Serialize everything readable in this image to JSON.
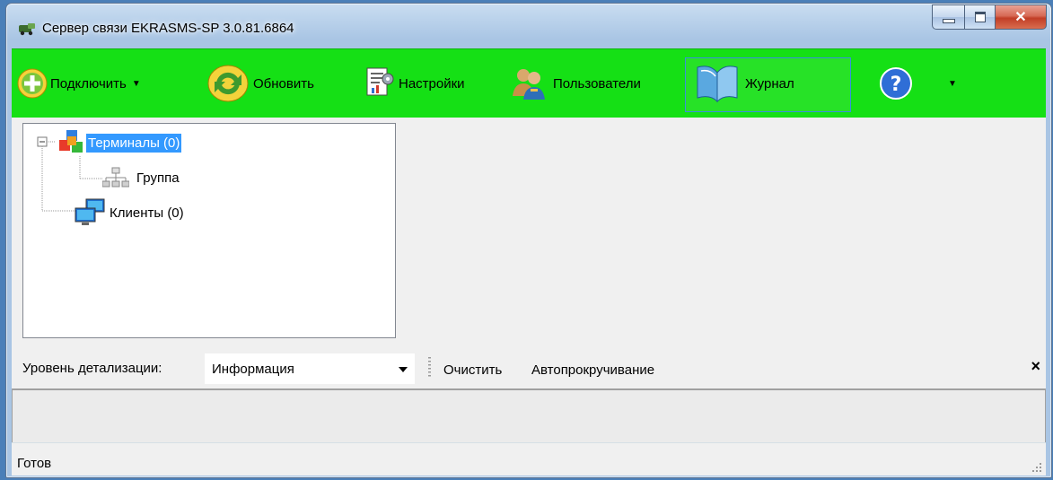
{
  "window": {
    "title": "Сервер связи EKRASMS-SP 3.0.81.6864"
  },
  "toolbar": {
    "connect_label": "Подключить",
    "refresh_label": "Обновить",
    "settings_label": "Настройки",
    "users_label": "Пользователи",
    "journal_label": "Журнал",
    "accent_color": "#15e015"
  },
  "tree": {
    "terminals_label": "Терминалы (0)",
    "group_label": "Группа",
    "clients_label": "Клиенты (0)"
  },
  "log_toolbar": {
    "detail_label": "Уровень детализации:",
    "detail_value": "Информация",
    "clear_label": "Очистить",
    "autoscroll_label": "Автопрокручивание",
    "close_label": "×"
  },
  "status": {
    "text": "Готов"
  }
}
